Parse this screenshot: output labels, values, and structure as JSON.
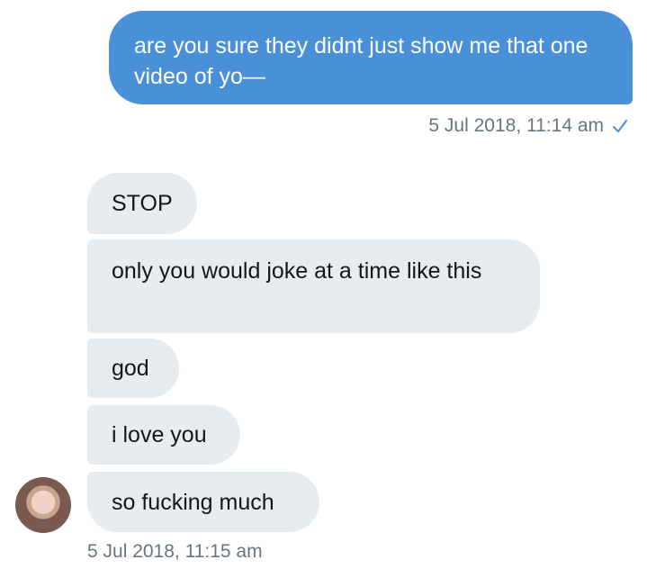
{
  "sent": {
    "text": "are you sure they didnt just show me that one video of yo—",
    "timestamp": "5 Jul 2018, 11:14 am",
    "status_icon": "checkmark-icon",
    "bubble_color": "#4a90d9"
  },
  "received": {
    "messages": [
      {
        "text": "STOP"
      },
      {
        "text": "only you would joke at a time like this"
      },
      {
        "text": "god"
      },
      {
        "text": "i love you"
      },
      {
        "text": "so fucking much"
      }
    ],
    "timestamp": "5 Jul 2018, 11:15 am",
    "bubble_color": "#e6ecf0",
    "avatar_icon": "user-avatar"
  }
}
